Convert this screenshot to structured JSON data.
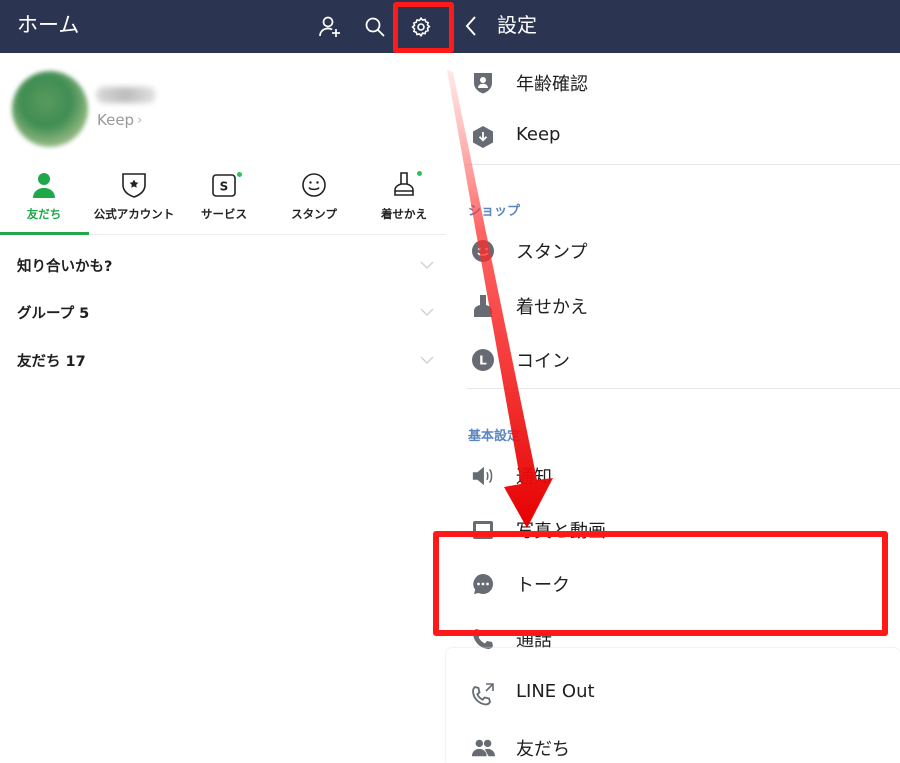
{
  "home": {
    "title": "ホーム",
    "profile": {
      "keep_label": "Keep",
      "keep_arrow": "›"
    },
    "tabs": [
      {
        "label": "友だち",
        "icon": "person-icon",
        "active": true
      },
      {
        "label": "公式アカウント",
        "icon": "official-account-icon",
        "active": false
      },
      {
        "label": "サービス",
        "icon": "services-icon",
        "active": false
      },
      {
        "label": "スタンプ",
        "icon": "sticker-icon",
        "active": false
      },
      {
        "label": "着せかえ",
        "icon": "theme-icon",
        "active": false
      }
    ],
    "sections": [
      {
        "label": "知り合いかも?"
      },
      {
        "label": "グループ 5"
      },
      {
        "label": "友だち 17"
      }
    ]
  },
  "settings": {
    "title": "設定",
    "items_top": [
      {
        "label": "年齢確認",
        "icon": "shield-person-icon"
      },
      {
        "label": "Keep",
        "icon": "keep-icon"
      }
    ],
    "shop": {
      "category": "ショップ",
      "items": [
        {
          "label": "スタンプ",
          "icon": "sticker-icon"
        },
        {
          "label": "着せかえ",
          "icon": "theme-icon"
        },
        {
          "label": "コイン",
          "icon": "coin-icon"
        }
      ]
    },
    "basic": {
      "category": "基本設定",
      "items": [
        {
          "label": "通知",
          "icon": "speaker-icon"
        },
        {
          "label": "写真と動画",
          "icon": "photo-icon"
        },
        {
          "label": "トーク",
          "icon": "chat-bubble-icon"
        },
        {
          "label": "通話",
          "icon": "phone-icon"
        },
        {
          "label": "LINE Out",
          "icon": "line-out-icon"
        },
        {
          "label": "友だち",
          "icon": "friends-icon"
        }
      ]
    }
  },
  "colors": {
    "header_bg": "#2b3450",
    "accent_green": "#1fa84a",
    "category_blue": "#5b86c0",
    "highlight_red": "#ff1a1a"
  }
}
